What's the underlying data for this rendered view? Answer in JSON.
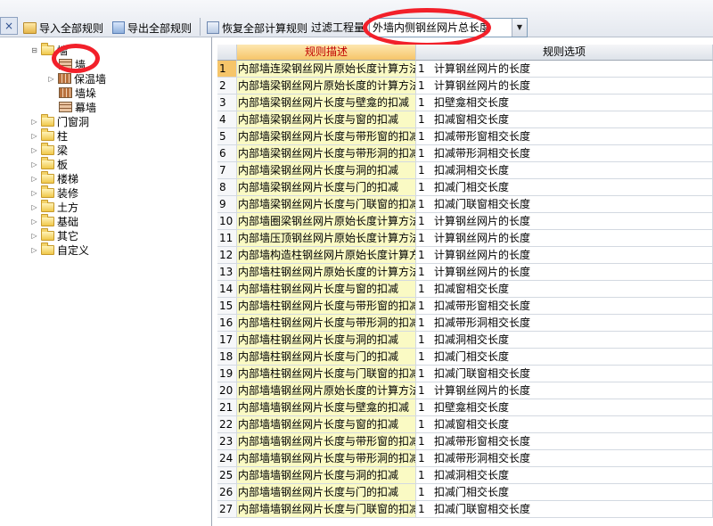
{
  "toolbar": {
    "close_glyph": "×",
    "import_label": "导入全部规则",
    "export_label": "导出全部规则",
    "restore_label": "恢复全部计算规则",
    "filter_label": "过滤工程量",
    "filter_value": "外墙内侧钢丝网片总长度",
    "dropdown_glyph": "▼"
  },
  "tree": {
    "root": "墙",
    "children": [
      "墙",
      "保温墙",
      "墙垛",
      "幕墙"
    ],
    "folders": [
      "门窗洞",
      "柱",
      "梁",
      "板",
      "楼梯",
      "装修",
      "土方",
      "基础",
      "其它",
      "自定义"
    ]
  },
  "grid": {
    "columns": [
      "规则描述",
      "规则选项"
    ],
    "selected_row": 1,
    "rows": [
      {
        "idx": "1",
        "desc": "内部墙连梁钢丝网片原始长度计算方法",
        "sel": "1",
        "opt": "计算钢丝网片的长度"
      },
      {
        "idx": "2",
        "desc": "内部墙梁钢丝网片原始长度的计算方法",
        "sel": "1",
        "opt": "计算钢丝网片的长度"
      },
      {
        "idx": "3",
        "desc": "内部墙梁钢丝网片长度与壁龛的扣减",
        "sel": "1",
        "opt": "扣壁龛相交长度"
      },
      {
        "idx": "4",
        "desc": "内部墙梁钢丝网片长度与窗的扣减",
        "sel": "1",
        "opt": "扣减窗相交长度"
      },
      {
        "idx": "5",
        "desc": "内部墙梁钢丝网片长度与带形窗的扣减",
        "sel": "1",
        "opt": "扣减带形窗相交长度"
      },
      {
        "idx": "6",
        "desc": "内部墙梁钢丝网片长度与带形洞的扣减",
        "sel": "1",
        "opt": "扣减带形洞相交长度"
      },
      {
        "idx": "7",
        "desc": "内部墙梁钢丝网片长度与洞的扣减",
        "sel": "1",
        "opt": "扣减洞相交长度"
      },
      {
        "idx": "8",
        "desc": "内部墙梁钢丝网片长度与门的扣减",
        "sel": "1",
        "opt": "扣减门相交长度"
      },
      {
        "idx": "9",
        "desc": "内部墙梁钢丝网片长度与门联窗的扣减",
        "sel": "1",
        "opt": "扣减门联窗相交长度"
      },
      {
        "idx": "10",
        "desc": "内部墙圈梁钢丝网片原始长度计算方法",
        "sel": "1",
        "opt": "计算钢丝网片的长度"
      },
      {
        "idx": "11",
        "desc": "内部墙压顶钢丝网片原始长度计算方法",
        "sel": "1",
        "opt": "计算钢丝网片的长度"
      },
      {
        "idx": "12",
        "desc": "内部墙构造柱钢丝网片原始长度计算方法",
        "sel": "1",
        "opt": "计算钢丝网片的长度"
      },
      {
        "idx": "13",
        "desc": "内部墙柱钢丝网片原始长度的计算方法",
        "sel": "1",
        "opt": "计算钢丝网片的长度"
      },
      {
        "idx": "14",
        "desc": "内部墙柱钢丝网片长度与窗的扣减",
        "sel": "1",
        "opt": "扣减窗相交长度"
      },
      {
        "idx": "15",
        "desc": "内部墙柱钢丝网片长度与带形窗的扣减",
        "sel": "1",
        "opt": "扣减带形窗相交长度"
      },
      {
        "idx": "16",
        "desc": "内部墙柱钢丝网片长度与带形洞的扣减",
        "sel": "1",
        "opt": "扣减带形洞相交长度"
      },
      {
        "idx": "17",
        "desc": "内部墙柱钢丝网片长度与洞的扣减",
        "sel": "1",
        "opt": "扣减洞相交长度"
      },
      {
        "idx": "18",
        "desc": "内部墙柱钢丝网片长度与门的扣减",
        "sel": "1",
        "opt": "扣减门相交长度"
      },
      {
        "idx": "19",
        "desc": "内部墙柱钢丝网片长度与门联窗的扣减",
        "sel": "1",
        "opt": "扣减门联窗相交长度"
      },
      {
        "idx": "20",
        "desc": "内部墙墙钢丝网片原始长度的计算方法",
        "sel": "1",
        "opt": "计算钢丝网片的长度"
      },
      {
        "idx": "21",
        "desc": "内部墙墙钢丝网片长度与壁龛的扣减",
        "sel": "1",
        "opt": "扣壁龛相交长度"
      },
      {
        "idx": "22",
        "desc": "内部墙墙钢丝网片长度与窗的扣减",
        "sel": "1",
        "opt": "扣减窗相交长度"
      },
      {
        "idx": "23",
        "desc": "内部墙墙钢丝网片长度与带形窗的扣减",
        "sel": "1",
        "opt": "扣减带形窗相交长度"
      },
      {
        "idx": "24",
        "desc": "内部墙墙钢丝网片长度与带形洞的扣减",
        "sel": "1",
        "opt": "扣减带形洞相交长度"
      },
      {
        "idx": "25",
        "desc": "内部墙墙钢丝网片长度与洞的扣减",
        "sel": "1",
        "opt": "扣减洞相交长度"
      },
      {
        "idx": "26",
        "desc": "内部墙墙钢丝网片长度与门的扣减",
        "sel": "1",
        "opt": "扣减门相交长度"
      },
      {
        "idx": "27",
        "desc": "内部墙墙钢丝网片长度与门联窗的扣减",
        "sel": "1",
        "opt": "扣减门联窗相交长度"
      }
    ]
  },
  "annotations": {
    "highlight_color": "#f2202a"
  }
}
